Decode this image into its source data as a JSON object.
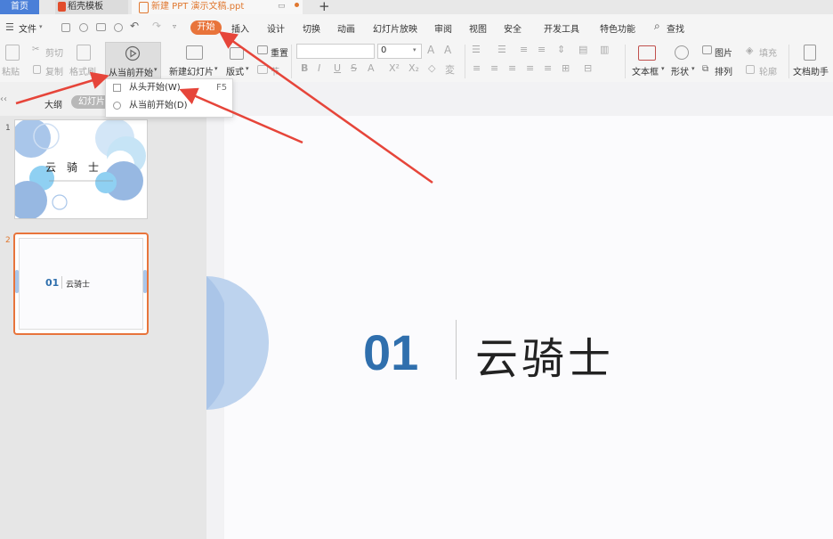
{
  "tabs": [
    {
      "label": "首页"
    },
    {
      "label": "稻壳模板"
    },
    {
      "label": "新建 PPT 演示文稿.ppt"
    }
  ],
  "menubar": {
    "file": "文件",
    "items": [
      "开始",
      "插入",
      "设计",
      "切换",
      "动画",
      "幻灯片放映",
      "审阅",
      "视图",
      "安全",
      "开发工具",
      "特色功能"
    ],
    "search": "查找"
  },
  "ribbon": {
    "paste": "粘贴",
    "cut": "剪切",
    "copy": "复制",
    "format_painter": "格式刷",
    "play_from_current": "从当前开始",
    "new_slide": "新建幻灯片",
    "layout": "版式",
    "section": "节",
    "reset": "重置",
    "font_size": "0",
    "text_box": "文本框",
    "shape": "形状",
    "arrange": "排列",
    "picture": "图片",
    "fill": "填充",
    "outline": "轮廓",
    "doc_assistant": "文档助手"
  },
  "panel_tabs": {
    "outline": "大纲",
    "slides": "幻灯片"
  },
  "dropdown": [
    {
      "label": "从头开始(W)",
      "shortcut": "F5"
    },
    {
      "label": "从当前开始(D)",
      "shortcut": ""
    }
  ],
  "thumbnails": [
    {
      "number": "1",
      "title": "云　骑　士"
    },
    {
      "number": "2",
      "num": "01",
      "title": "云骑士"
    }
  ],
  "slide": {
    "number": "01",
    "title": "云骑士"
  },
  "colors": {
    "accent_orange": "#e8743b",
    "tab_blue": "#4a7fd8",
    "annotation_red": "#e6453a",
    "slide_blue": "#2f6fad"
  }
}
